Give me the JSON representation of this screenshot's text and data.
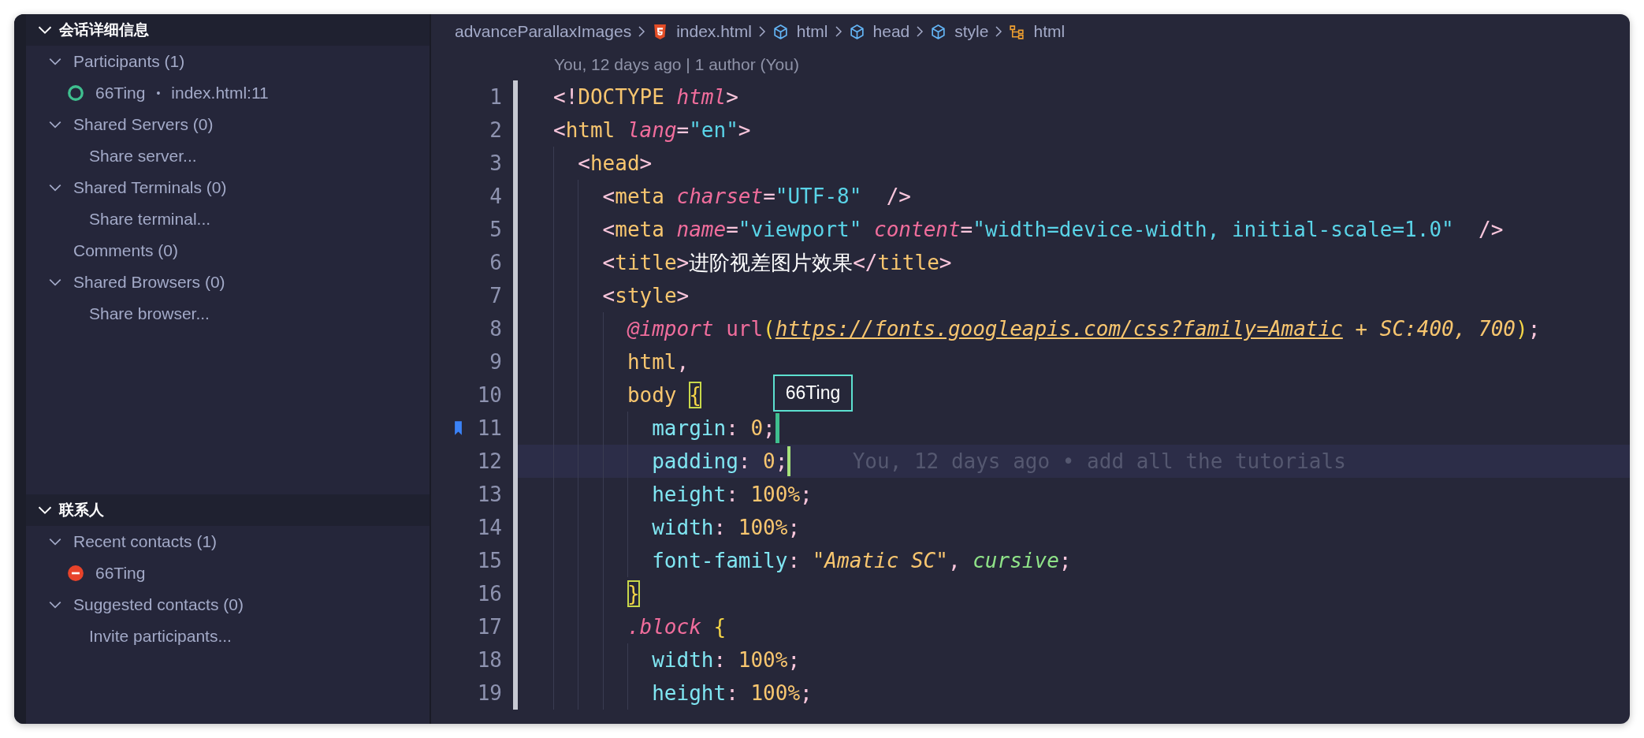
{
  "sidebar": {
    "sections": [
      {
        "title": "会话详细信息",
        "expanded": true,
        "items": [
          {
            "kind": "group",
            "label": "Participants (1)",
            "expanded": true,
            "children": [
              {
                "kind": "participant",
                "label": "66Ting",
                "separator": "•",
                "detail": "index.html:11"
              }
            ]
          },
          {
            "kind": "group",
            "label": "Shared Servers (0)",
            "expanded": true,
            "children": [
              {
                "kind": "action",
                "label": "Share server..."
              }
            ]
          },
          {
            "kind": "group",
            "label": "Shared Terminals (0)",
            "expanded": true,
            "children": [
              {
                "kind": "action",
                "label": "Share terminal..."
              }
            ]
          },
          {
            "kind": "leaf",
            "label": "Comments (0)"
          },
          {
            "kind": "group",
            "label": "Shared Browsers (0)",
            "expanded": true,
            "children": [
              {
                "kind": "action",
                "label": "Share browser..."
              }
            ]
          }
        ]
      },
      {
        "title": "联系人",
        "expanded": true,
        "items": [
          {
            "kind": "group",
            "label": "Recent contacts (1)",
            "expanded": true,
            "children": [
              {
                "kind": "contact",
                "label": "66Ting"
              }
            ]
          },
          {
            "kind": "group",
            "label": "Suggested contacts (0)",
            "expanded": true,
            "children": [
              {
                "kind": "action",
                "label": "Invite participants..."
              }
            ]
          }
        ]
      }
    ]
  },
  "breadcrumb": [
    {
      "label": "advanceParallaxImages",
      "kind": "folder"
    },
    {
      "label": "index.html",
      "kind": "file"
    },
    {
      "label": "html",
      "kind": "element"
    },
    {
      "label": "head",
      "kind": "element"
    },
    {
      "label": "style",
      "kind": "element"
    },
    {
      "label": "html",
      "kind": "selector"
    }
  ],
  "blame_header": "You, 12 days ago | 1 author (You)",
  "lines": [
    {
      "number": "1",
      "tokens": [
        {
          "t": "<!",
          "kind": "punct"
        },
        {
          "t": "DOCTYPE ",
          "kind": "tag"
        },
        {
          "t": "html",
          "kind": "attr"
        },
        {
          "t": ">",
          "kind": "punct"
        }
      ]
    },
    {
      "number": "2",
      "tokens": [
        {
          "t": "<",
          "kind": "punct"
        },
        {
          "t": "html ",
          "kind": "tag"
        },
        {
          "t": "lang",
          "kind": "attr"
        },
        {
          "t": "=",
          "kind": "punct"
        },
        {
          "t": "\"en\"",
          "kind": "str"
        },
        {
          "t": ">",
          "kind": "punct"
        }
      ],
      "children": [
        {
          "number": "3",
          "tokens": [
            {
              "t": "<",
              "kind": "punct"
            },
            {
              "t": "head",
              "kind": "tag"
            },
            {
              "t": ">",
              "kind": "punct"
            }
          ],
          "children": [
            {
              "number": "4",
              "tokens": [
                {
                  "t": "<",
                  "kind": "punct"
                },
                {
                  "t": "meta ",
                  "kind": "tag"
                },
                {
                  "t": "charset",
                  "kind": "attr"
                },
                {
                  "t": "=",
                  "kind": "punct"
                },
                {
                  "t": "\"UTF-8\"",
                  "kind": "str"
                },
                {
                  "t": "  />",
                  "kind": "punct"
                }
              ]
            },
            {
              "number": "5",
              "tokens": [
                {
                  "t": "<",
                  "kind": "punct"
                },
                {
                  "t": "meta ",
                  "kind": "tag"
                },
                {
                  "t": "name",
                  "kind": "attr"
                },
                {
                  "t": "=",
                  "kind": "punct"
                },
                {
                  "t": "\"viewport\" ",
                  "kind": "str"
                },
                {
                  "t": "content",
                  "kind": "attr"
                },
                {
                  "t": "=",
                  "kind": "punct"
                },
                {
                  "t": "\"width=device-width, initial-scale=1.0\"",
                  "kind": "str"
                },
                {
                  "t": "  />",
                  "kind": "punct"
                }
              ]
            },
            {
              "number": "6",
              "tokens": [
                {
                  "t": "<",
                  "kind": "punct"
                },
                {
                  "t": "title",
                  "kind": "tag"
                },
                {
                  "t": ">",
                  "kind": "punct"
                },
                {
                  "t": "进阶视差图片效果",
                  "kind": "text"
                },
                {
                  "t": "</",
                  "kind": "punct"
                },
                {
                  "t": "title",
                  "kind": "tag"
                },
                {
                  "t": ">",
                  "kind": "punct"
                }
              ]
            },
            {
              "number": "7",
              "tokens": [
                {
                  "t": "<",
                  "kind": "punct"
                },
                {
                  "t": "style",
                  "kind": "tag"
                },
                {
                  "t": ">",
                  "kind": "punct"
                }
              ],
              "children": [
                {
                  "number": "8",
                  "tokens": [
                    {
                      "t": "@import ",
                      "kind": "at"
                    },
                    {
                      "t": "url",
                      "kind": "fn"
                    },
                    {
                      "t": "(",
                      "kind": "paren"
                    },
                    {
                      "t": "https://fonts.googleapis.com/css?family=Amatic",
                      "kind": "url"
                    },
                    {
                      "t": " + SC:400, 700",
                      "kind": "istr"
                    },
                    {
                      "t": ")",
                      "kind": "paren"
                    },
                    {
                      "t": ";",
                      "kind": "punct"
                    }
                  ]
                },
                {
                  "number": "9",
                  "tokens": [
                    {
                      "t": "html",
                      "kind": "sel"
                    },
                    {
                      "t": ",",
                      "kind": "punct"
                    }
                  ]
                },
                {
                  "number": "10",
                  "tokens": [
                    {
                      "t": "body ",
                      "kind": "sel"
                    },
                    {
                      "t": "{",
                      "kind": "brace",
                      "matched": true
                    }
                  ],
                  "children": [
                    {
                      "number": "11",
                      "bookmarked": true,
                      "peer": {
                        "name": "66Ting"
                      },
                      "tokens": [
                        {
                          "t": "margin",
                          "kind": "prop"
                        },
                        {
                          "t": ": ",
                          "kind": "punct"
                        },
                        {
                          "t": "0",
                          "kind": "num"
                        },
                        {
                          "t": ";",
                          "kind": "punct"
                        }
                      ]
                    },
                    {
                      "number": "12",
                      "current": true,
                      "cursor": true,
                      "blame": "You, 12 days ago • add all the tutorials",
                      "tokens": [
                        {
                          "t": "padding",
                          "kind": "prop"
                        },
                        {
                          "t": ": ",
                          "kind": "punct"
                        },
                        {
                          "t": "0",
                          "kind": "num"
                        },
                        {
                          "t": ";",
                          "kind": "punct"
                        }
                      ]
                    },
                    {
                      "number": "13",
                      "tokens": [
                        {
                          "t": "height",
                          "kind": "prop"
                        },
                        {
                          "t": ": ",
                          "kind": "punct"
                        },
                        {
                          "t": "100%",
                          "kind": "num"
                        },
                        {
                          "t": ";",
                          "kind": "punct"
                        }
                      ]
                    },
                    {
                      "number": "14",
                      "tokens": [
                        {
                          "t": "width",
                          "kind": "prop"
                        },
                        {
                          "t": ": ",
                          "kind": "punct"
                        },
                        {
                          "t": "100%",
                          "kind": "num"
                        },
                        {
                          "t": ";",
                          "kind": "punct"
                        }
                      ]
                    },
                    {
                      "number": "15",
                      "tokens": [
                        {
                          "t": "font-family",
                          "kind": "prop"
                        },
                        {
                          "t": ": ",
                          "kind": "punct"
                        },
                        {
                          "t": "\"Amatic SC\"",
                          "kind": "istr"
                        },
                        {
                          "t": ", ",
                          "kind": "punct"
                        },
                        {
                          "t": "cursive",
                          "kind": "kw"
                        },
                        {
                          "t": ";",
                          "kind": "punct"
                        }
                      ]
                    }
                  ]
                },
                {
                  "number": "16",
                  "tokens": [
                    {
                      "t": "}",
                      "kind": "brace",
                      "matched": true
                    }
                  ]
                },
                {
                  "number": "17",
                  "tokens": [
                    {
                      "t": ".block ",
                      "kind": "cls"
                    },
                    {
                      "t": "{",
                      "kind": "brace"
                    }
                  ],
                  "children": [
                    {
                      "number": "18",
                      "tokens": [
                        {
                          "t": "width",
                          "kind": "prop"
                        },
                        {
                          "t": ": ",
                          "kind": "punct"
                        },
                        {
                          "t": "100%",
                          "kind": "num"
                        },
                        {
                          "t": ";",
                          "kind": "punct"
                        }
                      ]
                    },
                    {
                      "number": "19",
                      "tokens": [
                        {
                          "t": "height",
                          "kind": "prop"
                        },
                        {
                          "t": ": ",
                          "kind": "punct"
                        },
                        {
                          "t": "100%",
                          "kind": "num"
                        },
                        {
                          "t": ";",
                          "kind": "punct"
                        }
                      ]
                    }
                  ]
                }
              ]
            }
          ]
        }
      ]
    }
  ]
}
